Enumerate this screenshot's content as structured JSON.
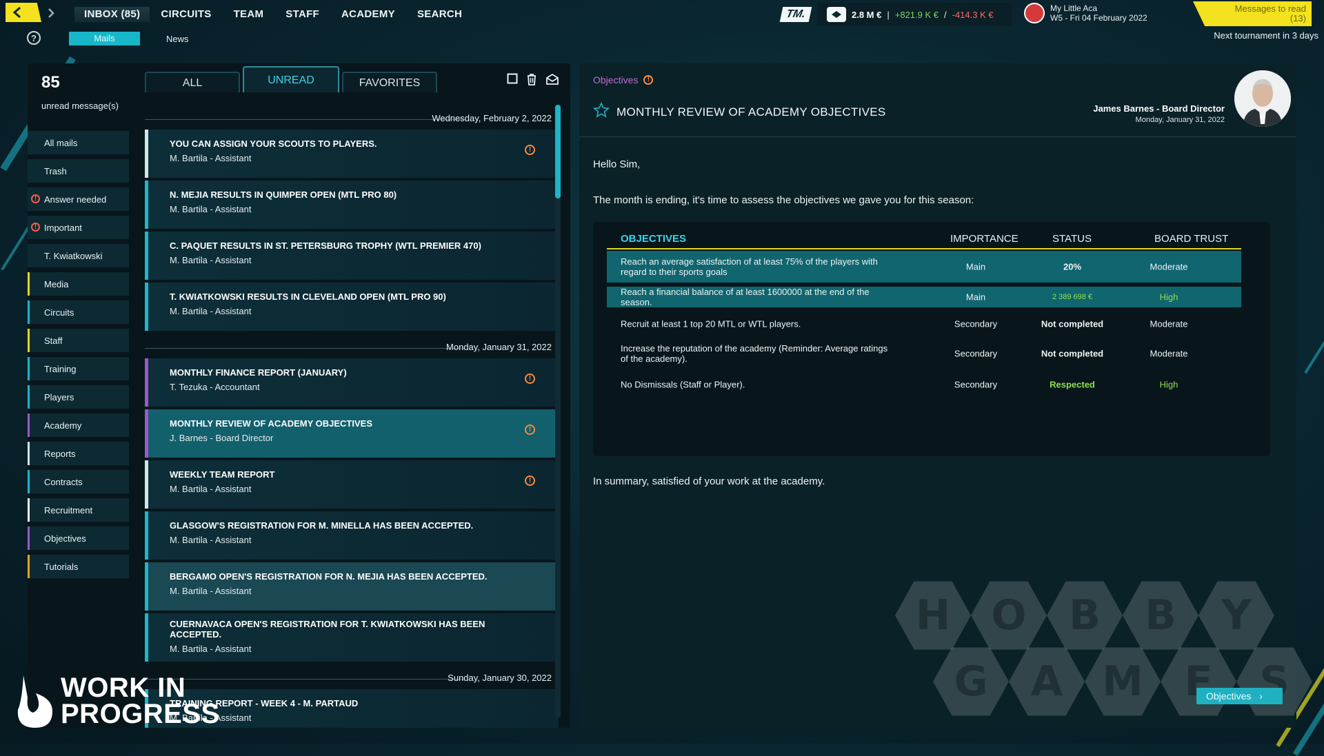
{
  "topbar": {
    "nav": [
      {
        "label": "INBOX (85)",
        "active": true
      },
      {
        "label": "CIRCUITS"
      },
      {
        "label": "TEAM"
      },
      {
        "label": "STAFF"
      },
      {
        "label": "ACADEMY"
      },
      {
        "label": "SEARCH"
      }
    ],
    "subnav": {
      "mails": "Mails",
      "news": "News"
    },
    "logo": "TM.",
    "finance": {
      "balance": "2.8 M €",
      "income": "+821.9 K €",
      "sep": "|",
      "slash": "/",
      "expense": "-414.3 K €"
    },
    "club": {
      "name": "My Little Aca",
      "date": "W5 - Fri 04 February 2022"
    },
    "messages_to_read": {
      "label": "Messages to read",
      "count": "(13)"
    },
    "next_tournament": "Next tournament in 3 days",
    "help": "?"
  },
  "sidebar": {
    "count": "85",
    "count_label": "unread message(s)",
    "categories": [
      {
        "label": "All mails",
        "color": "#0d2a33"
      },
      {
        "label": "Trash",
        "color": "#0d2a33"
      },
      {
        "label": "Answer needed",
        "icon": "warning-icon"
      },
      {
        "label": "Important",
        "icon": "warning-icon"
      },
      {
        "label": "T. Kwiatkowski",
        "color": "#0d2a33"
      },
      {
        "label": "Media",
        "color": "#e2d726"
      },
      {
        "label": "Circuits",
        "color": "#1fb6c8"
      },
      {
        "label": "Staff",
        "color": "#e2d726"
      },
      {
        "label": "Training",
        "color": "#1fb6c8"
      },
      {
        "label": "Players",
        "color": "#1fb6c8"
      },
      {
        "label": "Academy",
        "color": "#9b59c9"
      },
      {
        "label": "Reports",
        "color": "#cfe6ea"
      },
      {
        "label": "Contracts",
        "color": "#1fb6c8"
      },
      {
        "label": "Recruitment",
        "color": "#f5f7f7"
      },
      {
        "label": "Objectives",
        "color": "#9b59c9"
      },
      {
        "label": "Tutorials",
        "color": "#f0a21e"
      }
    ]
  },
  "tabs": [
    {
      "label": "ALL"
    },
    {
      "label": "UNREAD",
      "active": true
    },
    {
      "label": "FAVORITES"
    }
  ],
  "mail_groups": [
    {
      "date": "Wednesday, February 2, 2022",
      "mails": [
        {
          "subject": "You can assign your scouts to players.",
          "from": "M. Bartila - Assistant",
          "color": "#cfe6ea",
          "alert": true
        },
        {
          "subject": "N. Mejia results in Quimper Open (MTL PRO 80)",
          "from": "M. Bartila - Assistant",
          "color": "#1fb6c8"
        },
        {
          "subject": "C. Paquet results in St. Petersburg Trophy (WTL Premier 470)",
          "from": "M. Bartila - Assistant",
          "color": "#1fb6c8"
        },
        {
          "subject": "T. Kwiatkowski results in Cleveland Open (MTL PRO 90)",
          "from": "M. Bartila - Assistant",
          "color": "#1fb6c8"
        }
      ]
    },
    {
      "date": "Monday, January 31, 2022",
      "mails": [
        {
          "subject": "Monthly finance report (January)",
          "from": "T. Tezuka - Accountant",
          "color": "#9b59c9",
          "alert": true
        },
        {
          "subject": "Monthly review of academy objectives",
          "from": "J. Barnes - Board Director",
          "color": "#9b59c9",
          "alert": true,
          "selected": true
        },
        {
          "subject": "Weekly team report",
          "from": "M. Bartila - Assistant",
          "color": "#cfe6ea",
          "alert": true
        },
        {
          "subject": "Glasgow's registration for M. Minella has been accepted.",
          "from": "M. Bartila - Assistant",
          "color": "#1fb6c8"
        },
        {
          "subject": "Bergamo Open's registration for N. Mejia has been accepted.",
          "from": "M. Bartila - Assistant",
          "color": "#1fb6c8",
          "highlight": true
        },
        {
          "subject": "Cuernavaca Open's registration for T. Kwiatkowski has been accepted.",
          "from": "M. Bartila - Assistant",
          "color": "#1fb6c8",
          "tall": true
        }
      ]
    },
    {
      "date": "Sunday, January 30, 2022",
      "mails": [
        {
          "subject": "Training report - Week 4 - M. Partaud",
          "from": "M. Bartila - Assistant",
          "color": "#1fb6c8"
        }
      ]
    }
  ],
  "message": {
    "breadcrumb": "Objectives",
    "title": "MONTHLY REVIEW OF ACADEMY OBJECTIVES",
    "sender": "James Barnes - Board Director",
    "date": "Monday, January 31, 2022",
    "greeting": "Hello Sim,",
    "intro": "The month is ending, it's time to assess the objectives we gave you for this season:",
    "summary": "In summary, satisfied of your work at the academy.",
    "objectives": {
      "headers": [
        "OBJECTIVES",
        "IMPORTANCE",
        "STATUS",
        "BOARD TRUST"
      ],
      "rows": [
        {
          "desc": "Reach an average satisfaction of at least 75% of the players with regard to their sports goals",
          "importance": "Main",
          "status": "20%",
          "trust": "Moderate",
          "done": true
        },
        {
          "desc": "Reach a financial balance of at least 1600000 at the end of the season.",
          "importance": "Main",
          "status": "2 389 698 €",
          "trust": "High",
          "done": true,
          "green": true
        },
        {
          "desc": "Recruit at least 1 top 20 MTL or WTL players.",
          "importance": "Secondary",
          "status": "Not completed",
          "trust": "Moderate"
        },
        {
          "desc": "Increase the reputation of the academy (Reminder: Average ratings of the academy).",
          "importance": "Secondary",
          "status": "Not completed",
          "trust": "Moderate"
        },
        {
          "desc": "No Dismissals (Staff or Player).",
          "importance": "Secondary",
          "status": "Respected",
          "trust": "High",
          "green": true
        }
      ]
    }
  },
  "overlays": {
    "hobby_letters": [
      "H",
      "O",
      "B",
      "B",
      "Y",
      "G",
      "A",
      "M",
      "E",
      "S"
    ],
    "objectives_button": "Objectives",
    "wip_line1": "WORK IN",
    "wip_line2": "PROGRESS"
  }
}
